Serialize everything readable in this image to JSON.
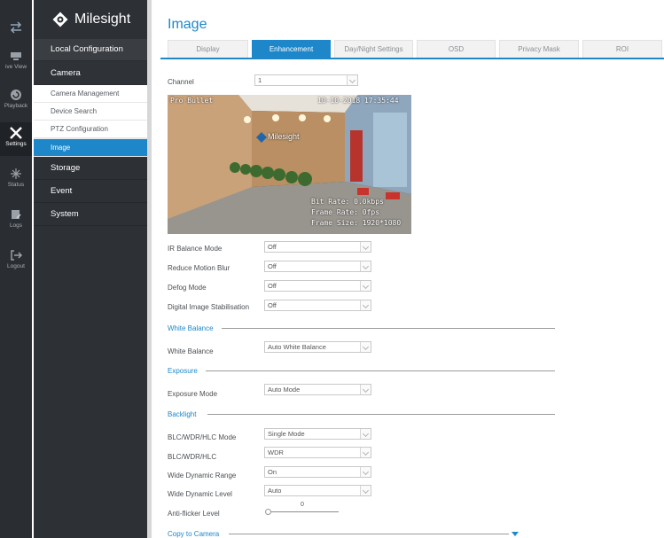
{
  "colors": {
    "accent": "#1d87c9",
    "rail_bg": "#2a2d32",
    "menu_dark": "#2d3035"
  },
  "rail": [
    {
      "icon": "swap-arrows-icon",
      "label": ""
    },
    {
      "icon": "live-view-icon",
      "label": "ive View"
    },
    {
      "icon": "playback-icon",
      "label": "Playback"
    },
    {
      "icon": "settings-tools-icon",
      "label": "Settings"
    },
    {
      "icon": "status-icon",
      "label": "Status"
    },
    {
      "icon": "logs-icon",
      "label": "Logs"
    },
    {
      "icon": "logout-icon",
      "label": "Logout"
    }
  ],
  "brand": {
    "name": "Milesight",
    "icon": "milesight-logo-icon"
  },
  "menu": {
    "local_configuration": "Local Configuration",
    "camera": "Camera",
    "camera_items": [
      "Camera Management",
      "Device Search",
      "PTZ Configuration",
      "Image"
    ],
    "storage": "Storage",
    "event": "Event",
    "system": "System"
  },
  "page": {
    "title": "Image",
    "tabs": [
      "Display",
      "Enhancement",
      "Day/Night Settings",
      "OSD",
      "Privacy Mask",
      "ROI"
    ],
    "active_tab": "Enhancement"
  },
  "channel": {
    "label": "Channel",
    "value": "1"
  },
  "preview": {
    "camera_name": "Pro Bullet",
    "timestamp": "10-10-2018 17:35:44",
    "bit_rate": "Bit Rate: 0.0kbps",
    "frame_rate": "Frame Rate: 0fps",
    "frame_size": "Frame Size: 1920*1080",
    "wall_logo": "Milesight"
  },
  "fields": [
    {
      "label": "IR Balance Mode",
      "value": "Off"
    },
    {
      "label": "Reduce Motion Blur",
      "value": "Off"
    },
    {
      "label": "Defog Mode",
      "value": "Off"
    },
    {
      "label": "Digital Image Stabilisation",
      "value": "Off"
    }
  ],
  "white_balance": {
    "section": "White Balance",
    "label": "White Balance",
    "value": "Auto White Balance"
  },
  "exposure": {
    "section": "Exposure",
    "label": "Exposure Mode",
    "value": "Auto Mode"
  },
  "backlight": {
    "section": "Backlight",
    "fields": [
      {
        "label": "BLC/WDR/HLC Mode",
        "value": "Single Mode"
      },
      {
        "label": "BLC/WDR/HLC",
        "value": "WDR"
      },
      {
        "label": "Wide Dynamic Range",
        "value": "On"
      },
      {
        "label": "Wide Dynamic Level",
        "value": "Auto"
      }
    ],
    "anti_flicker": {
      "label": "Anti-flicker Level",
      "value": "0"
    }
  },
  "copy": {
    "label": "Copy to Camera"
  }
}
